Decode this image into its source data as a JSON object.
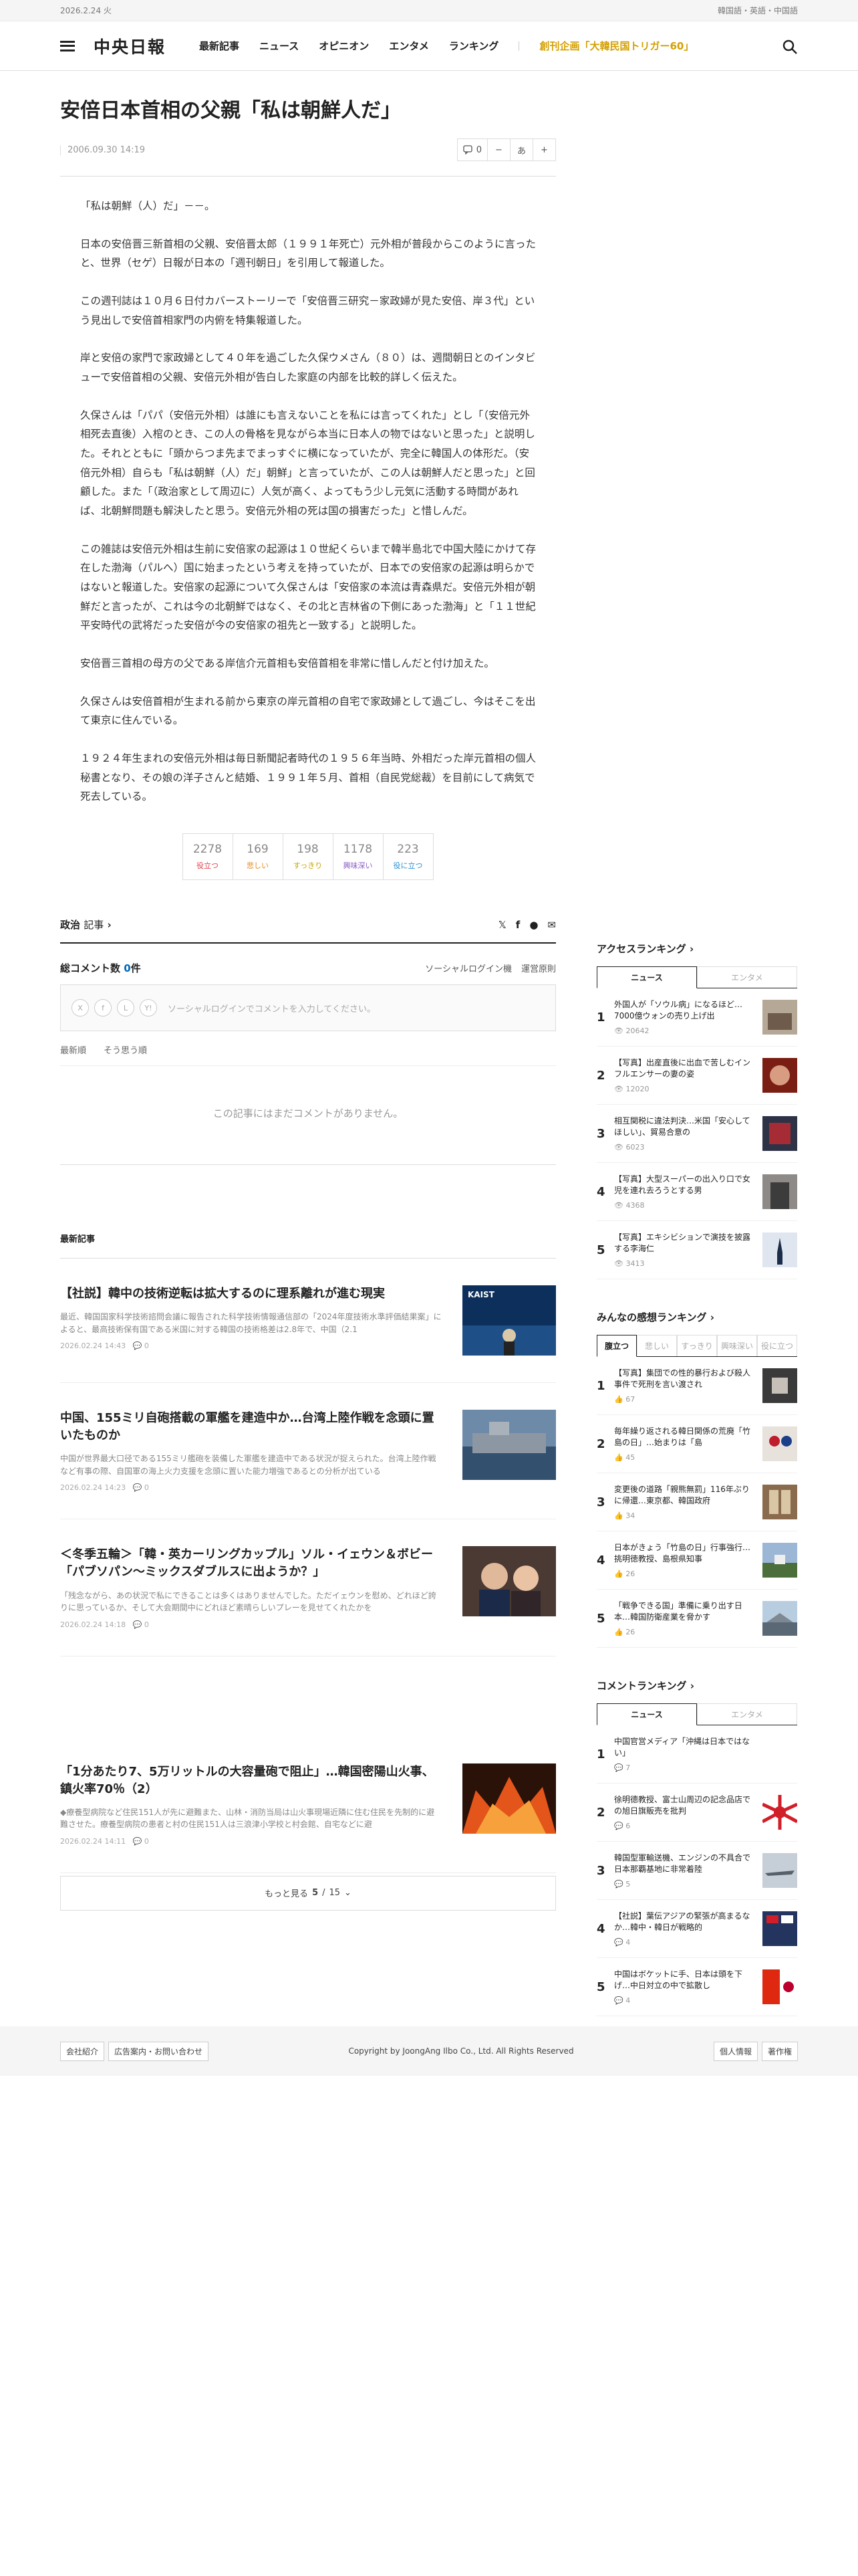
{
  "topbar": {
    "date": "2026.2.24 火",
    "langs": "韓国語・英語・中国語"
  },
  "header": {
    "logo": "中央日報",
    "nav": [
      "最新記事",
      "ニュース",
      "オピニオン",
      "エンタメ",
      "ランキング"
    ],
    "special": "創刊企画「大韓民国トリガー60」"
  },
  "article": {
    "headline": "安倍日本首相の父親「私は朝鮮人だ」",
    "date": "2006.09.30 14:19",
    "comment_count_tool": "0",
    "font_tool": "あ",
    "paragraphs": [
      "「私は朝鮮（人）だ」－－。",
      "日本の安倍晋三新首相の父親、安倍晋太郎（１９９１年死亡）元外相が普段からこのように言ったと、世界（セゲ）日報が日本の「週刊朝日」を引用して報道した。",
      "この週刊誌は１０月６日付カバーストーリーで「安倍晋三研究－家政婦が見た安倍、岸３代」という見出しで安倍首相家門の内俯を特集報道した。",
      "岸と安倍の家門で家政婦として４０年を過ごした久保ウメさん（８０）は、週間朝日とのインタビューで安倍首相の父親、安倍元外相が告白した家庭の内部を比較的詳しく伝えた。",
      "久保さんは「パパ（安倍元外相）は誰にも言えないことを私には言ってくれた」とし「（安倍元外相死去直後）入棺のとき、この人の骨格を見ながら本当に日本人の物ではないと思った」と説明した。それとともに「頭からつま先までまっすぐに横になっていたが、完全に韓国人の体形だ。（安倍元外相）自らも「私は朝鮮（人）だ」朝鮮」と言っていたが、この人は朝鮮人だと思った」と回顧した。また「（政治家として周辺に）人気が高く、よってもう少し元気に活動する時間があれば、北朝鮮問題も解決したと思う。安倍元外相の死は国の損害だった」と惜しんだ。",
      "この雑誌は安倍元外相は生前に安倍家の起源は１０世紀くらいまで韓半島北で中国大陸にかけて存在した渤海（パルへ）国に始まったという考えを持っていたが、日本での安倍家の起源は明らかではないと報道した。安倍家の起源について久保さんは「安倍家の本流は青森県だ。安倍元外相が朝鮮だと言ったが、これは今の北朝鮮ではなく、その北と吉林省の下側にあった渤海」と「１１世紀平安時代の武将だった安倍が今の安倍家の祖先と一致する」と説明した。",
      "安倍晋三首相の母方の父である岸信介元首相も安倍首相を非常に惜しんだと付け加えた。",
      "久保さんは安倍首相が生まれる前から東京の岸元首相の自宅で家政婦として過ごし、今はそこを出て東京に住んでいる。",
      "１９２４年生まれの安倍元外相は毎日新聞記者時代の１９５６年当時、外相だった岸元首相の個人秘書となり、その娘の洋子さんと結婚、１９９１年５月、首相（自民党総裁）を目前にして病気で死去している。"
    ]
  },
  "reactions": [
    {
      "count": "2278",
      "label": "役立つ",
      "color": "#e0464f"
    },
    {
      "count": "169",
      "label": "悲しい",
      "color": "#e58a1f"
    },
    {
      "count": "198",
      "label": "すっきり",
      "color": "#c8a400"
    },
    {
      "count": "1178",
      "label": "興味深い",
      "color": "#8a5cc4"
    },
    {
      "count": "223",
      "label": "役に立つ",
      "color": "#2a8fd6"
    }
  ],
  "category": {
    "name": "政治",
    "suffix": "記事"
  },
  "comments": {
    "title": "総コメント数",
    "count": "0",
    "unit": "件",
    "social": "ソーシャルログイン機",
    "policy": "運営原則",
    "placeholder": "ソーシャルログインでコメントを入力してください。",
    "tab1": "最新順",
    "tab2": "そう思う順",
    "empty": "この記事にはまだコメントがありません。"
  },
  "latest": {
    "title": "最新記事",
    "items": [
      {
        "title": "【社説】韓中の技術逆転は拡大するのに理系離れが進む現実",
        "summary": "最近、韓国国家科学技術諮問会議に報告された科学技術情報通信部の「2024年度技術水準評価結果案」によると、最高技術保有国である米国に対する韓国の技術格差は2.8年で、中国（2.1",
        "date": "2026.02.24 14:43",
        "comments": "0"
      },
      {
        "title": "中国、155ミリ自砲搭載の軍艦を建造中か…台湾上陸作戦を念頭に置いたものか",
        "summary": "中国が世界最大口径である155ミリ艦砲を装備した軍艦を建造中である状況が捉えられた。台湾上陸作戦など有事の際、自国軍の海上火力支援を念頭に置いた能力増強であるとの分析が出ている",
        "date": "2026.02.24 14:23",
        "comments": "0"
      },
      {
        "title": "＜冬季五輪＞「韓・英カーリングカップル」ソル・イェウン＆ボビー「パブソパン～ミックスダブルスに出ようか？」",
        "summary": "「残念ながら、あの状況で私にできることは多くはありませんでした。ただイェウンを慰め、どれほど誇りに思っているか、そして大会期間中にどれほど素晴らしいプレーを見せてくれたかを",
        "date": "2026.02.24 14:18",
        "comments": "0"
      },
      {
        "title": "「1分あたり7、5万リットルの大容量砲で阻止」…韓国密陽山火事、鎮火率70％（2）",
        "summary": "◆療養型病院など住民151人が先に避難また、山林・消防当局は山火事現場近隣に住む住民を先制的に避難させた。療養型病院の患者と村の住民151人は三浪津小学校と村会館、自宅などに避",
        "date": "2026.02.24 14:11",
        "comments": "0"
      }
    ],
    "more_label": "もっと見る",
    "page": "5",
    "total": "15"
  },
  "sidebar": {
    "access": {
      "title": "アクセスランキング",
      "tabs": [
        "ニュース",
        "エンタメ"
      ],
      "items": [
        {
          "rank": "1",
          "title": "外国人が「ソウル病」になるほど…7000億ウォンの売り上げ出",
          "views": "20642"
        },
        {
          "rank": "2",
          "title": "【写真】出産直後に出血で苦しむインフルエンサーの妻の姿",
          "views": "12020"
        },
        {
          "rank": "3",
          "title": "相互関税に違法判決…米国「安心してほしい」、貿易合意の",
          "views": "6023"
        },
        {
          "rank": "4",
          "title": "【写真】大型スーパーの出入り口で女児を連れ去ろうとする男",
          "views": "4368"
        },
        {
          "rank": "5",
          "title": "【写真】エキシビションで演技を披露する李海仁",
          "views": "3413"
        }
      ]
    },
    "impression": {
      "title": "みんなの感想ランキング",
      "tabs": [
        "腹立つ",
        "悲しい",
        "すっきり",
        "興味深い",
        "役に立つ"
      ],
      "items": [
        {
          "rank": "1",
          "title": "【写真】集団での性的暴行および殺人事件で死刑を言い渡され",
          "views": "67"
        },
        {
          "rank": "2",
          "title": "毎年繰り返される韓日関係の荒廃「竹島の日」…始まりは「島",
          "views": "45"
        },
        {
          "rank": "3",
          "title": "変更後の道路「親熊無罰」116年ぶりに帰還…東京都、韓国政府",
          "views": "34"
        },
        {
          "rank": "4",
          "title": "日本がきょう「竹島の日」行事強行…挑明徳教授、島根県知事",
          "views": "26"
        },
        {
          "rank": "5",
          "title": "「戦争できる国」準備に乗り出す日本…韓国防衛産業を脅かす",
          "views": "26"
        }
      ]
    },
    "comment": {
      "title": "コメントランキング",
      "tabs": [
        "ニュース",
        "エンタメ"
      ],
      "items": [
        {
          "rank": "1",
          "title": "中国官営メディア「沖縄は日本ではない」",
          "views": "7"
        },
        {
          "rank": "2",
          "title": "徐明德教授、富士山周辺の記念品店での旭日旗販売を批判",
          "views": "6"
        },
        {
          "rank": "3",
          "title": "韓国型軍輸送機、エンジンの不具合で日本那覇基地に非常着陸",
          "views": "5"
        },
        {
          "rank": "4",
          "title": "【社説】葉伝アジアの緊張が高まるなか…韓中・韓日が戦略的",
          "views": "4"
        },
        {
          "rank": "5",
          "title": "中国はボケットに手、日本は頭を下げ…中日対立の中で拡散し",
          "views": "4"
        }
      ]
    }
  },
  "footer": {
    "links": [
      "会社紹介",
      "広告案内・お問い合わせ"
    ],
    "copyright": "Copyright by JoongAng Ilbo Co., Ltd. All Rights Reserved",
    "right": [
      "個人情報",
      "著作権"
    ]
  }
}
